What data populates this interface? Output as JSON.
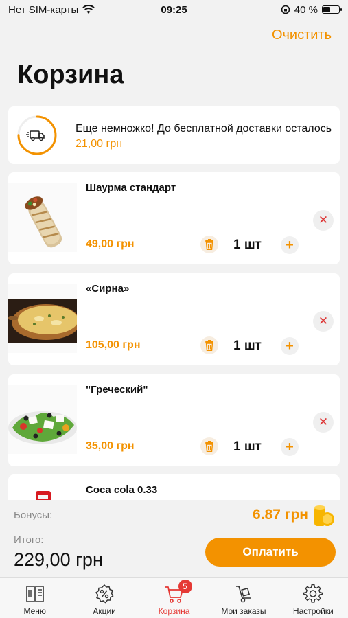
{
  "status_bar": {
    "carrier": "Нет SIM-карты",
    "time": "09:25",
    "battery": "40 %",
    "battery_level": 0.4
  },
  "header": {
    "clear_label": "Очистить",
    "title": "Корзина"
  },
  "delivery": {
    "message": "Еще немножко! До бесплатной доставки осталось ",
    "remaining": "21,00 грн",
    "progress": 0.75
  },
  "cart_items": [
    {
      "name": "Шаурма стандарт",
      "price": "49,00 грн",
      "qty": "1 шт"
    },
    {
      "name": "«Сирна»",
      "price": "105,00 грн",
      "qty": "1 шт"
    },
    {
      "name": "\"Греческий\"",
      "price": "35,00 грн",
      "qty": "1 шт"
    },
    {
      "name": "Coca cola 0.33"
    }
  ],
  "summary": {
    "bonus_label": "Бонусы:",
    "bonus_value": "6.87 грн",
    "total_label": "Итого:",
    "total_value": "229,00 грн",
    "pay_label": "Оплатить"
  },
  "tabs": [
    {
      "label": "Меню",
      "icon": "menu-book-icon"
    },
    {
      "label": "Акции",
      "icon": "discount-icon"
    },
    {
      "label": "Корзина",
      "icon": "cart-icon",
      "badge": "5",
      "active": true
    },
    {
      "label": "Мои заказы",
      "icon": "hand-truck-icon"
    },
    {
      "label": "Настройки",
      "icon": "gear-icon"
    }
  ],
  "colors": {
    "accent": "#f39200",
    "active_tab": "#e53935"
  }
}
